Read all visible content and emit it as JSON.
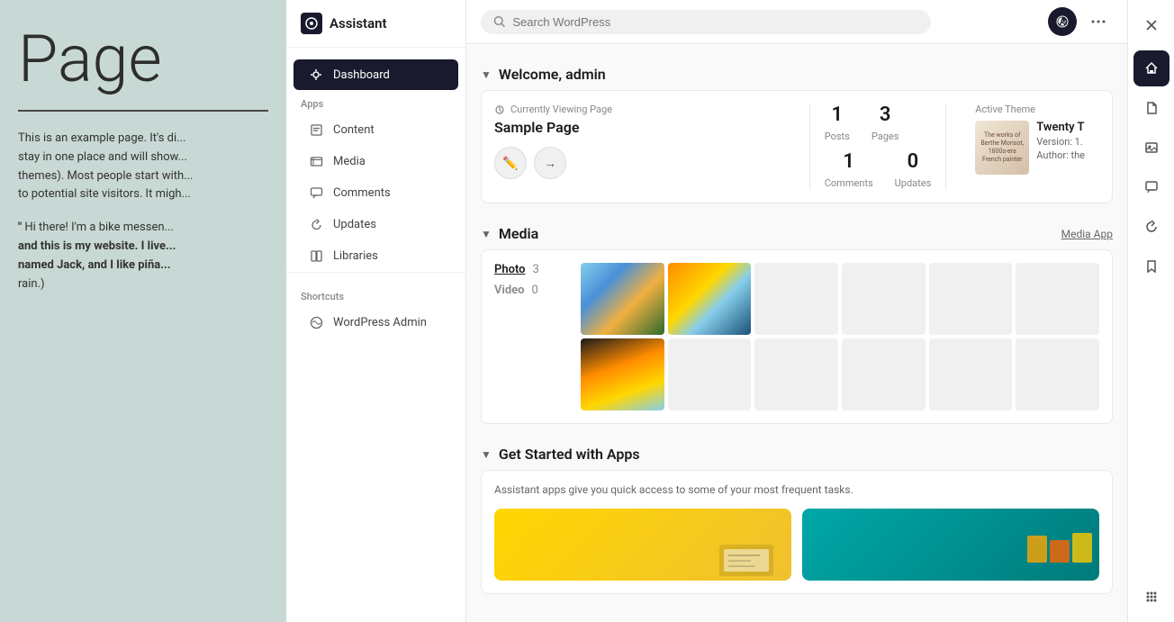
{
  "page": {
    "background_title": "Page",
    "background_text1": "This is an example page. It's di... stay in one place and will show... themes). Most people start with... to potential site visitors. It migh...",
    "background_quote": "\" Hi there! I'm a bike messen... and this is my website. I live... named Jack, and I like piña... rain.)"
  },
  "sidebar": {
    "title": "Assistant",
    "logo_icon": "assistant-icon",
    "dashboard_label": "Dashboard",
    "apps_section_label": "Apps",
    "nav_items": [
      {
        "id": "dashboard",
        "label": "Dashboard",
        "icon": "dashboard-icon",
        "active": true
      },
      {
        "id": "content",
        "label": "Content",
        "icon": "content-icon"
      },
      {
        "id": "media",
        "label": "Media",
        "icon": "media-icon"
      },
      {
        "id": "comments",
        "label": "Comments",
        "icon": "comments-icon"
      },
      {
        "id": "updates",
        "label": "Updates",
        "icon": "updates-icon"
      },
      {
        "id": "libraries",
        "label": "Libraries",
        "icon": "libraries-icon"
      }
    ],
    "shortcuts_label": "Shortcuts",
    "shortcuts": [
      {
        "id": "wp-admin",
        "label": "WordPress Admin",
        "icon": "wp-icon"
      }
    ]
  },
  "topbar": {
    "search_placeholder": "Search WordPress",
    "wp_button": "wp-logo",
    "more_button": "more-icon"
  },
  "welcome": {
    "section_title": "Welcome, admin",
    "viewing_label": "Currently Viewing Page",
    "page_title": "Sample Page",
    "edit_button": "edit-icon",
    "view_button": "arrow-right-icon",
    "stats": {
      "posts_count": "1",
      "posts_label": "Posts",
      "pages_count": "3",
      "pages_label": "Pages",
      "comments_count": "1",
      "comments_label": "Comments",
      "updates_count": "0",
      "updates_label": "Updates"
    },
    "active_theme_label": "Active Theme",
    "theme_name": "Twenty T",
    "theme_version": "Version: 1.",
    "theme_author": "Author: the"
  },
  "media": {
    "section_title": "Media",
    "media_app_link": "Media App",
    "photo_label": "Photo",
    "photo_count": "3",
    "video_label": "Video",
    "video_count": "0",
    "grid_cells": [
      {
        "type": "filled-1"
      },
      {
        "type": "filled-2"
      },
      {
        "type": "empty"
      },
      {
        "type": "empty"
      },
      {
        "type": "empty"
      },
      {
        "type": "empty"
      },
      {
        "type": "filled-3"
      },
      {
        "type": "empty"
      },
      {
        "type": "empty"
      },
      {
        "type": "empty"
      },
      {
        "type": "empty"
      },
      {
        "type": "empty"
      }
    ]
  },
  "apps": {
    "section_title": "Get Started with Apps",
    "description": "Assistant apps give you quick access to some of your most frequent tasks.",
    "cards": [
      {
        "id": "app1",
        "theme": "yellow"
      },
      {
        "id": "app2",
        "theme": "teal"
      }
    ]
  },
  "right_sidebar": {
    "icons": [
      {
        "id": "home",
        "icon": "home-icon",
        "active": true
      },
      {
        "id": "file",
        "icon": "file-icon",
        "active": false
      },
      {
        "id": "image",
        "icon": "image-icon",
        "active": false
      },
      {
        "id": "chat",
        "icon": "chat-icon",
        "active": false
      },
      {
        "id": "refresh",
        "icon": "refresh-icon",
        "active": false
      },
      {
        "id": "bookmark",
        "icon": "bookmark-icon",
        "active": false
      },
      {
        "id": "grid",
        "icon": "grid-icon",
        "active": false
      }
    ],
    "close_button": "close-icon"
  }
}
